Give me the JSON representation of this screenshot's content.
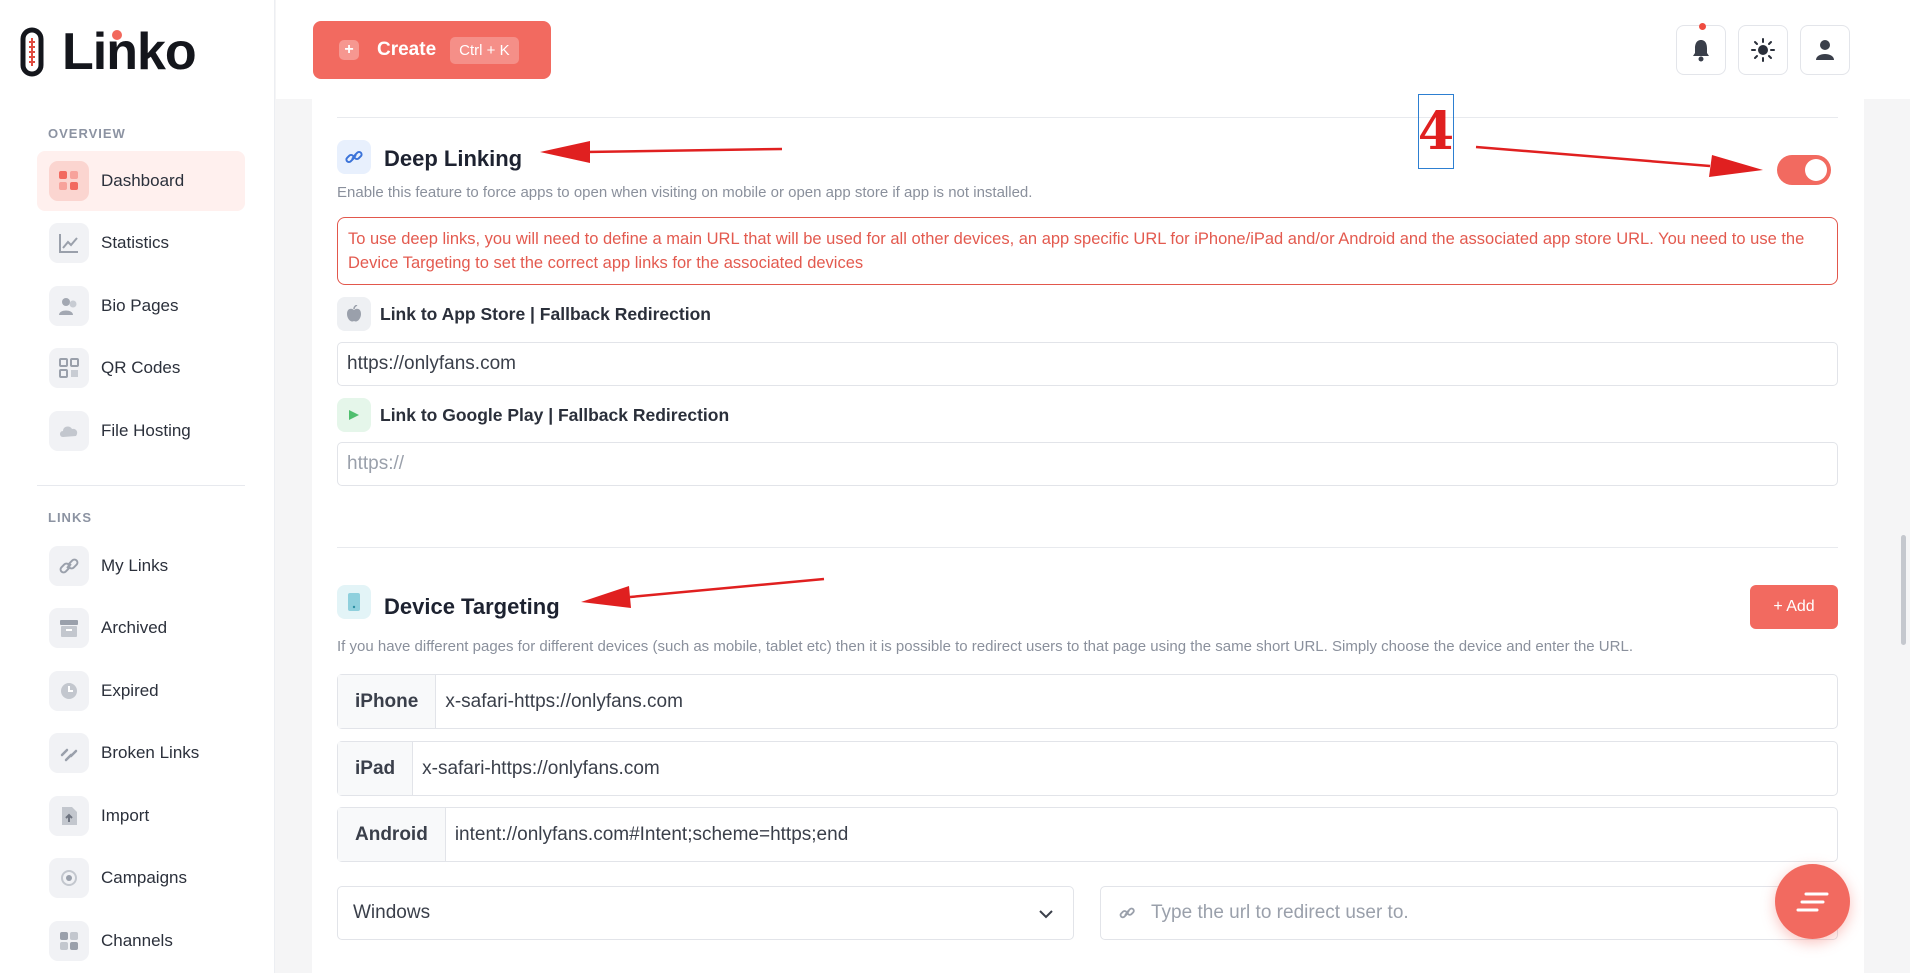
{
  "brand": {
    "name": "Linko"
  },
  "sidebar": {
    "overview_title": "OVERVIEW",
    "links_title": "LINKS",
    "overview_items": [
      {
        "label": "Dashboard",
        "icon": "dashboard-icon",
        "active": true
      },
      {
        "label": "Statistics",
        "icon": "chart-icon"
      },
      {
        "label": "Bio Pages",
        "icon": "users-icon"
      },
      {
        "label": "QR Codes",
        "icon": "qr-icon"
      },
      {
        "label": "File Hosting",
        "icon": "cloud-icon"
      }
    ],
    "link_items": [
      {
        "label": "My Links",
        "icon": "link-icon"
      },
      {
        "label": "Archived",
        "icon": "archive-icon"
      },
      {
        "label": "Expired",
        "icon": "clock-icon"
      },
      {
        "label": "Broken Links",
        "icon": "broken-link-icon"
      },
      {
        "label": "Import",
        "icon": "import-icon"
      },
      {
        "label": "Campaigns",
        "icon": "target-icon"
      },
      {
        "label": "Channels",
        "icon": "grid-icon"
      }
    ]
  },
  "topbar": {
    "create_label": "Create",
    "create_shortcut": "Ctrl + K",
    "icons": [
      "bell-icon",
      "sun-icon",
      "user-icon"
    ]
  },
  "deep_linking": {
    "title": "Deep Linking",
    "description": "Enable this feature to force apps to open when visiting on mobile or open app store if app is not installed.",
    "enabled": true,
    "alert": "To use deep links, you will need to define a main URL that will be used for all other devices, an app specific URL for iPhone/iPad and/or Android and the associated app store URL. You need to use the Device Targeting to set the correct app links for the associated devices",
    "app_store_label": "Link to App Store | Fallback Redirection",
    "app_store_value": "https://onlyfans.com",
    "google_play_label": "Link to Google Play | Fallback Redirection",
    "google_play_placeholder": "https://"
  },
  "device_targeting": {
    "title": "Device Targeting",
    "add_label": "+ Add",
    "description": "If you have different pages for different devices (such as mobile, tablet etc) then it is possible to redirect users to that page using the same short URL. Simply choose the device and enter the URL.",
    "rows": [
      {
        "device": "iPhone",
        "url": "x-safari-https://onlyfans.com"
      },
      {
        "device": "iPad",
        "url": "x-safari-https://onlyfans.com"
      },
      {
        "device": "Android",
        "url": "intent://onlyfans.com#Intent;scheme=https;end"
      }
    ],
    "select_value": "Windows",
    "url_placeholder": "Type the url to redirect user to."
  },
  "annotation": {
    "number": "4",
    "color": "#e02020"
  },
  "colors": {
    "accent": "#f26a60",
    "alert": "#e2574c",
    "annotation_box": "#2d7fd1"
  }
}
